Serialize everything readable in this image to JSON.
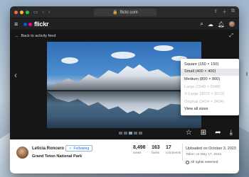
{
  "browser": {
    "url": "flickr.com",
    "lock_icon": "lock-icon"
  },
  "header": {
    "logo_text": "flickr",
    "logo_colors": {
      "blue": "#0063dc",
      "pink": "#ff0084"
    }
  },
  "viewer": {
    "back_label": "Back to activity feed"
  },
  "size_menu": {
    "items": [
      {
        "label": "Square (150 × 150)",
        "state": "normal"
      },
      {
        "label": "Small (400 × 400)",
        "state": "selected"
      },
      {
        "label": "Medium (800 × 800)",
        "state": "normal"
      },
      {
        "label": "Large (2048 × 2048)",
        "state": "disabled"
      },
      {
        "label": "X-Large (3072 × 3072)",
        "state": "disabled"
      },
      {
        "label": "Original (3424 × 3424)",
        "state": "disabled"
      },
      {
        "label": "View all sizes",
        "state": "normal"
      }
    ]
  },
  "info": {
    "owner_name": "Leticia Roncero",
    "follow_label": "Following",
    "photo_title": "Grand Teton National Park",
    "stats": [
      {
        "value": "8,498",
        "label": "views"
      },
      {
        "value": "163",
        "label": "faves"
      },
      {
        "value": "17",
        "label": "comments"
      }
    ],
    "uploaded": "Uploaded on October 3, 2023",
    "taken": "Taken on May 17, 2022",
    "rights": "All rights reserved"
  }
}
